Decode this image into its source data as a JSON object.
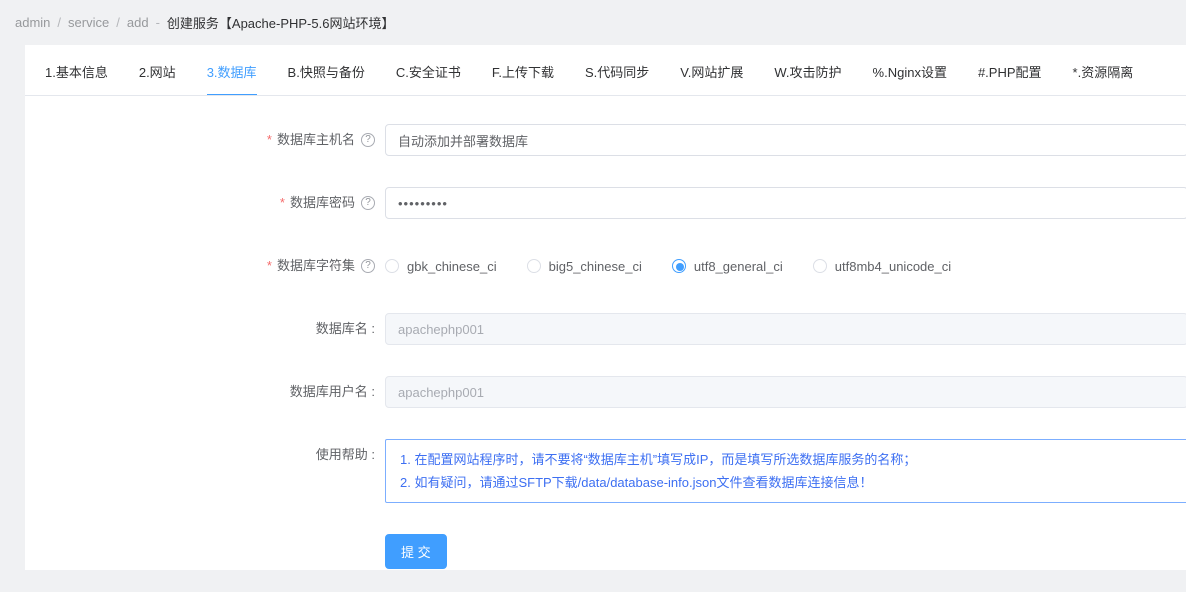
{
  "breadcrumb": {
    "items": [
      "admin",
      "service",
      "add"
    ],
    "separator": "/",
    "dash": "-",
    "title": "创建服务【Apache-PHP-5.6网站环境】"
  },
  "tabs": [
    {
      "label": "1.基本信息",
      "active": false
    },
    {
      "label": "2.网站",
      "active": false
    },
    {
      "label": "3.数据库",
      "active": true
    },
    {
      "label": "B.快照与备份",
      "active": false
    },
    {
      "label": "C.安全证书",
      "active": false
    },
    {
      "label": "F.上传下载",
      "active": false
    },
    {
      "label": "S.代码同步",
      "active": false
    },
    {
      "label": "V.网站扩展",
      "active": false
    },
    {
      "label": "W.攻击防护",
      "active": false
    },
    {
      "label": "%.Nginx设置",
      "active": false
    },
    {
      "label": "#.PHP配置",
      "active": false
    },
    {
      "label": "*.资源隔离",
      "active": false
    }
  ],
  "icons": {
    "question_glyph": "?"
  },
  "form": {
    "required_mark": "*",
    "db_host": {
      "label": "数据库主机名",
      "value": "自动添加并部署数据库"
    },
    "db_password": {
      "label": "数据库密码",
      "value": "•••••••••"
    },
    "db_charset": {
      "label": "数据库字符集",
      "options": [
        "gbk_chinese_ci",
        "big5_chinese_ci",
        "utf8_general_ci",
        "utf8mb4_unicode_ci"
      ],
      "selected": "utf8_general_ci"
    },
    "db_name": {
      "label": "数据库名 :",
      "value": "apachephp001",
      "disabled": true
    },
    "db_user": {
      "label": "数据库用户名 :",
      "value": "apachephp001",
      "disabled": true
    },
    "help": {
      "label": "使用帮助 :",
      "lines": [
        "1. 在配置网站程序时，请不要将“数据库主机”填写成IP，而是填写所选数据库服务的名称；",
        "2. 如有疑问，请通过SFTP下载/data/database-info.json文件查看数据库连接信息！"
      ]
    },
    "submit_label": "提 交"
  },
  "colors": {
    "accent": "#409eff",
    "required": "#f56c6c",
    "help_text": "#3d6ff2",
    "help_border": "#7caeff",
    "page_background": "#f0f1f3"
  }
}
